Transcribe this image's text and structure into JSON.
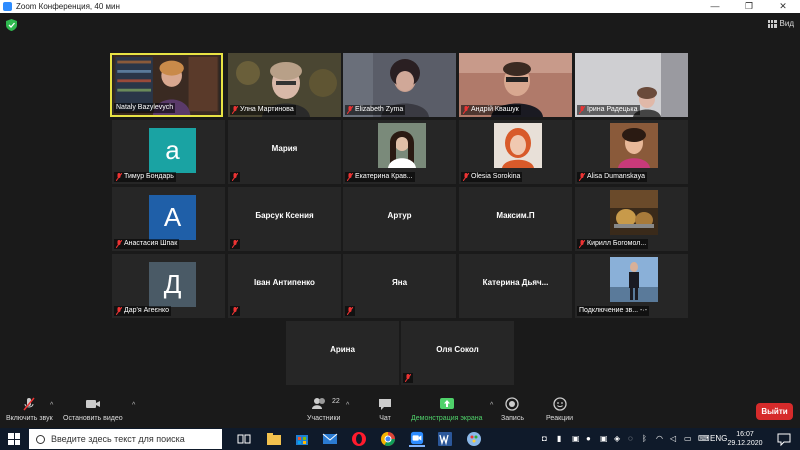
{
  "window": {
    "title": "Zoom Конференция, 40 мин",
    "minimize": "—",
    "restore": "❐",
    "close": "✕"
  },
  "topbar": {
    "view_label": "Вид"
  },
  "tiles_row1": [
    {
      "name": "Nataly Bazylevych"
    },
    {
      "name": "Улна Мартинова"
    },
    {
      "name": "Elizabeth Zyma"
    },
    {
      "name": "Андрій Квашук"
    },
    {
      "name": "Ірина Радецька"
    }
  ],
  "tiles_row2": [
    {
      "name": "Тимур Бондарь",
      "avatar": "a"
    },
    {
      "name": "Мария"
    },
    {
      "name": "Екатерина Крав..."
    },
    {
      "name": "Olesia Sorokina"
    },
    {
      "name": "Alisa Dumanskaya"
    }
  ],
  "tiles_row3": [
    {
      "name": "Анастасия Шпак",
      "avatar": "A"
    },
    {
      "name": "Барсук Ксения"
    },
    {
      "name": "Артур"
    },
    {
      "name": "Максим.П"
    },
    {
      "name": "Кирилл Богомол..."
    }
  ],
  "tiles_row4": [
    {
      "name": "Дар'я Агеєнко",
      "avatar": "Д"
    },
    {
      "name": "Іван Антипенко"
    },
    {
      "name": "Яна"
    },
    {
      "name": "Катерина Дьяч..."
    },
    {
      "name": "Подключение зв... -·-"
    }
  ],
  "tiles_row5": [
    {
      "name": "Арина"
    },
    {
      "name": "Оля Сокол"
    }
  ],
  "toolbar": {
    "unmute": "Включить звук",
    "stop_video": "Остановить видео",
    "participants": "Участники",
    "participants_count": "22",
    "chat": "Чат",
    "share": "Демонстрация экрана",
    "record": "Запись",
    "reactions": "Реакции",
    "leave": "Выйти"
  },
  "taskbar": {
    "search_placeholder": "Введите здесь текст для поиска",
    "lang": "ENG",
    "time": "16:07",
    "date": "29.12.2020"
  },
  "colors": {
    "active_speaker": "#e8e344",
    "share_green": "#4fd16a",
    "leave_red": "#d62b2b",
    "avatar_teal": "#1aa3a3",
    "avatar_blue": "#1f5fa8",
    "avatar_slate": "#4a5a66"
  }
}
